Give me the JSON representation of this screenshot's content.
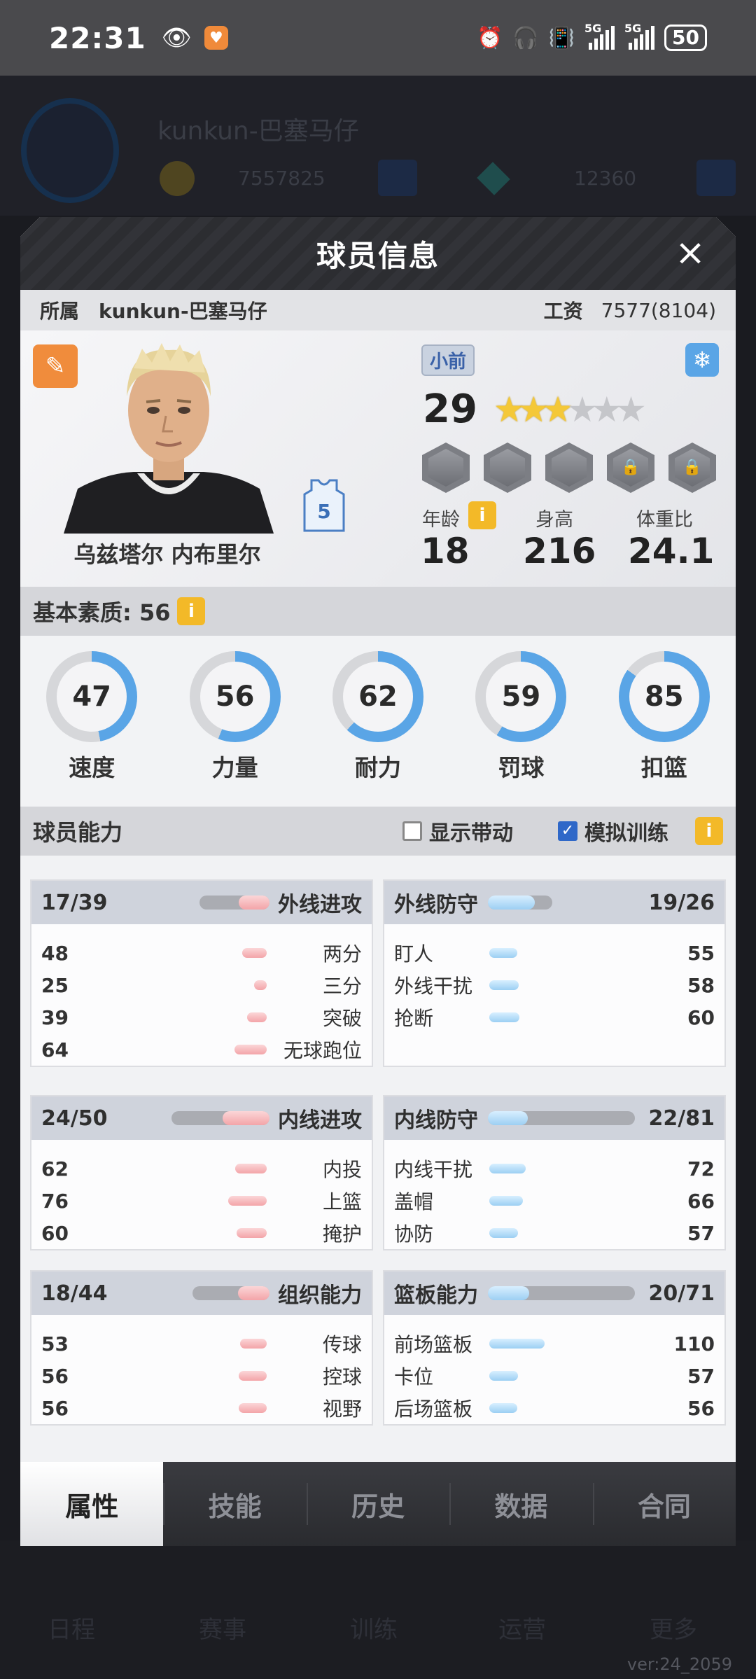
{
  "status_bar": {
    "time": "22:31",
    "net1": "5G",
    "net2": "5G",
    "battery": "50"
  },
  "background": {
    "name": "kunkun-巴塞马仔",
    "coins": "7557825",
    "gems": "12360",
    "version": "ver:24_2059"
  },
  "panel": {
    "title": "球员信息",
    "close_icon": "×",
    "owner_label": "所属",
    "owner_value": "kunkun-巴塞马仔",
    "salary_label": "工资",
    "salary_value": "7577(8104)"
  },
  "player": {
    "name": "乌兹塔尔 内布里尔",
    "jersey_number": "5",
    "position": "小前",
    "overall": "29",
    "stars_filled": 3,
    "stars_total": 6,
    "age_label": "年龄",
    "age": "18",
    "height_label": "身高",
    "height": "216",
    "weight_label": "体重比",
    "weight": "24.1"
  },
  "basic": {
    "title": "基本素质: 56",
    "info": "i",
    "stats": [
      {
        "label": "速度",
        "value": "47"
      },
      {
        "label": "力量",
        "value": "56"
      },
      {
        "label": "耐力",
        "value": "62"
      },
      {
        "label": "罚球",
        "value": "59"
      },
      {
        "label": "扣篮",
        "value": "85"
      }
    ]
  },
  "abilities": {
    "title": "球员能力",
    "option1": "显示带动",
    "option1_checked": false,
    "option2": "模拟训练",
    "option2_checked": true,
    "info": "i",
    "blocks": [
      {
        "title": "外线进攻",
        "score": "17/39",
        "fill": 0.44,
        "rows": [
          {
            "label": "两分",
            "value": "48"
          },
          {
            "label": "三分",
            "value": "25"
          },
          {
            "label": "突破",
            "value": "39"
          },
          {
            "label": "无球跑位",
            "value": "64"
          }
        ]
      },
      {
        "title": "外线防守",
        "score": "19/26",
        "fill": 0.73,
        "rows": [
          {
            "label": "盯人",
            "value": "55"
          },
          {
            "label": "外线干扰",
            "value": "58"
          },
          {
            "label": "抢断",
            "value": "60"
          }
        ]
      },
      {
        "title": "内线进攻",
        "score": "24/50",
        "fill": 0.48,
        "rows": [
          {
            "label": "内投",
            "value": "62"
          },
          {
            "label": "上篮",
            "value": "76"
          },
          {
            "label": "掩护",
            "value": "60"
          }
        ]
      },
      {
        "title": "内线防守",
        "score": "22/81",
        "fill": 0.27,
        "rows": [
          {
            "label": "内线干扰",
            "value": "72"
          },
          {
            "label": "盖帽",
            "value": "66"
          },
          {
            "label": "协防",
            "value": "57"
          }
        ]
      },
      {
        "title": "组织能力",
        "score": "18/44",
        "fill": 0.41,
        "rows": [
          {
            "label": "传球",
            "value": "53"
          },
          {
            "label": "控球",
            "value": "56"
          },
          {
            "label": "视野",
            "value": "56"
          }
        ]
      },
      {
        "title": "篮板能力",
        "score": "20/71",
        "fill": 0.28,
        "rows": [
          {
            "label": "前场篮板",
            "value": "110"
          },
          {
            "label": "卡位",
            "value": "57"
          },
          {
            "label": "后场篮板",
            "value": "56"
          }
        ]
      }
    ]
  },
  "tabs": [
    "属性",
    "技能",
    "历史",
    "数据",
    "合同"
  ],
  "bottom_nav": [
    "日程",
    "赛事",
    "训练",
    "运营",
    "更多"
  ],
  "colors": {
    "accent_orange": "#f08c3c",
    "ring_blue": "#5aa5e6",
    "bar_pink": "#f3a4a8",
    "bar_blue": "#9ccff3"
  }
}
